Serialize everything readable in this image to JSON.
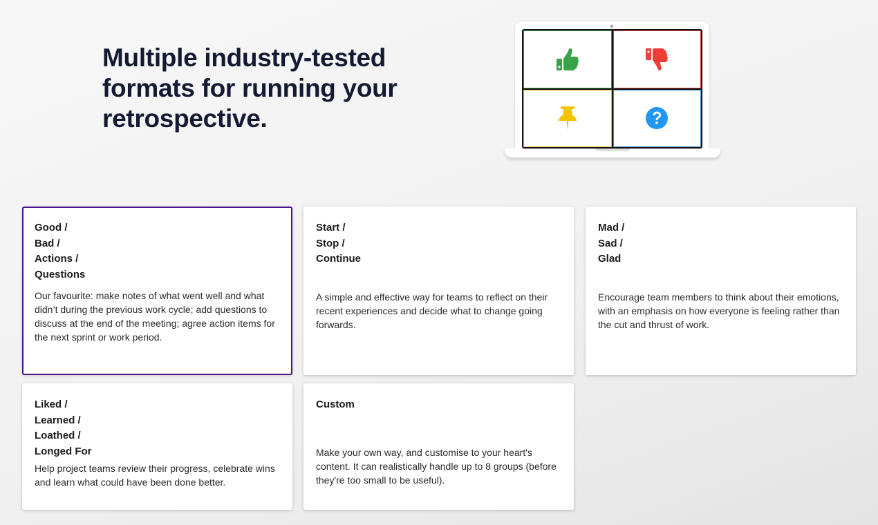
{
  "hero": {
    "title": "Multiple industry-tested formats for running your retrospective."
  },
  "illustration": {
    "quadrants": [
      {
        "icon": "thumbs-up-icon",
        "color": "#3aa34a",
        "border": "#3e9a48"
      },
      {
        "icon": "thumbs-down-icon",
        "color": "#ef3e36",
        "border": "#d33a33"
      },
      {
        "icon": "pushpin-icon",
        "color": "#f5c400",
        "border": "#e8c21a"
      },
      {
        "icon": "question-icon",
        "color": "#2196f3",
        "border": "#3c8fd6"
      }
    ]
  },
  "formats": [
    {
      "title_lines": [
        "Good /",
        "Bad /",
        "Actions /",
        "Questions"
      ],
      "description": "Our favourite: make notes of what went well and what didn’t during the previous work cycle; add questions to discuss at the end of the meeting; agree action items for the next sprint or work period.",
      "selected": true
    },
    {
      "title_lines": [
        "Start /",
        "Stop /",
        "Continue"
      ],
      "description": "A simple and effective way for teams to reflect on their recent experiences and decide what to change going forwards.",
      "selected": false
    },
    {
      "title_lines": [
        "Mad /",
        "Sad /",
        "Glad"
      ],
      "description": "Encourage team members to think about their emotions, with an emphasis on how everyone is feeling rather than the cut and thrust of work.",
      "selected": false
    },
    {
      "title_lines": [
        "Liked /",
        "Learned /",
        "Loathed /",
        "Longed For"
      ],
      "description": "Help project teams review their progress, celebrate wins and learn what could have been done better.",
      "selected": false
    },
    {
      "title_lines": [
        "Custom"
      ],
      "description": "Make your own way, and customise to your heart's content. It can realistically handle up to 8 groups (before they're too small to be useful).",
      "selected": false
    }
  ],
  "colors": {
    "selected_border": "#4b148f",
    "heading": "#151a33"
  }
}
